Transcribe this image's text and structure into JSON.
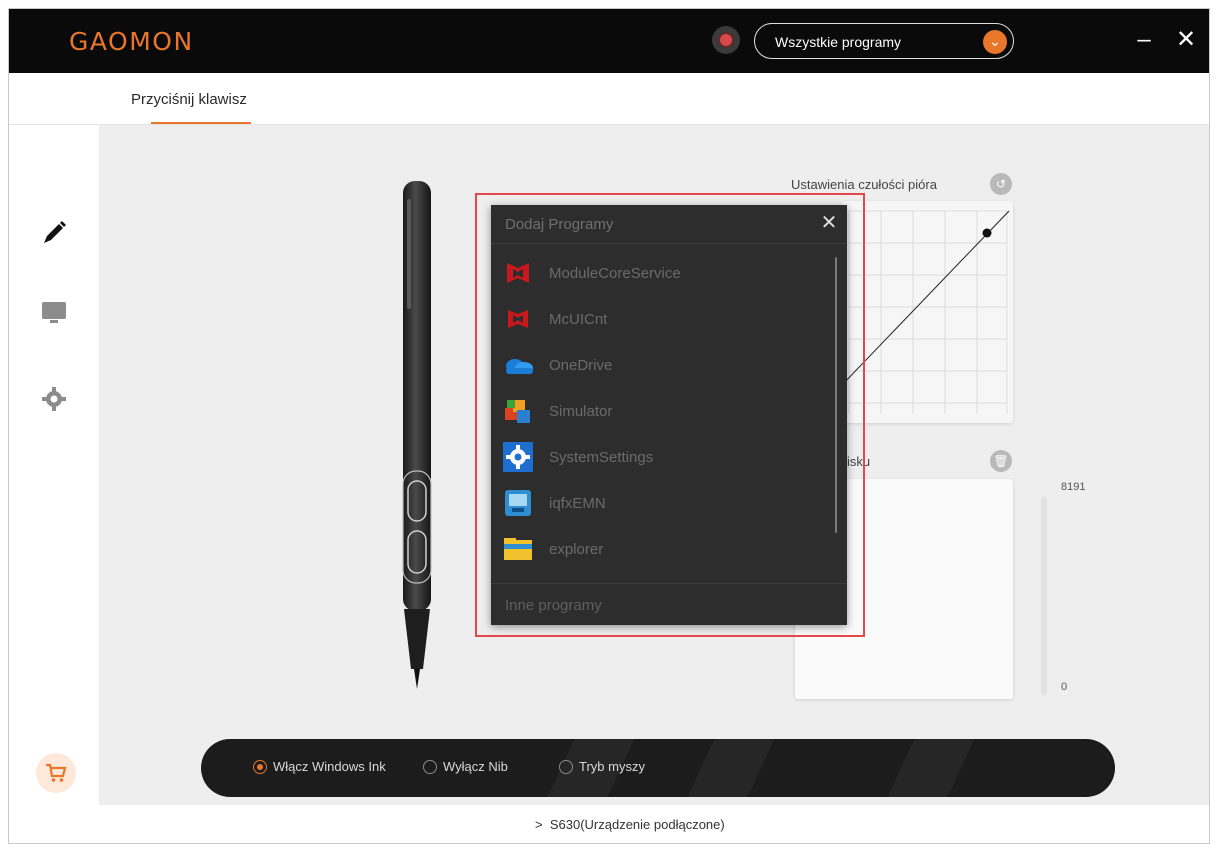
{
  "app": {
    "logo": "GAOMON",
    "program_select": "Wszystkie programy",
    "minimize_label": "–",
    "close_label": "✕"
  },
  "tabs": [
    {
      "label": "Przyciśnij klawisz",
      "active": true
    }
  ],
  "sidebar": {
    "items": [
      {
        "icon": "pen-icon",
        "active": true
      },
      {
        "icon": "monitor-icon",
        "active": false
      },
      {
        "icon": "gear-icon",
        "active": false
      }
    ],
    "shop_icon": "cart-icon"
  },
  "pen_curve": {
    "title": "Ustawienia czułości pióra",
    "reset_icon": "reset-icon"
  },
  "pressure": {
    "title": "isku",
    "max": "8191",
    "min": "0",
    "trash_icon": "trash-icon"
  },
  "dialog": {
    "title": "Dodaj Programy",
    "close_label": "✕",
    "items": [
      {
        "label": "ModuleCoreService",
        "icon": "mcafee-icon"
      },
      {
        "label": "McUICnt",
        "icon": "mcafee-icon"
      },
      {
        "label": "OneDrive",
        "icon": "onedrive-icon"
      },
      {
        "label": "Simulator",
        "icon": "simulator-icon"
      },
      {
        "label": "SystemSettings",
        "icon": "settings-gear-icon"
      },
      {
        "label": "iqfxEMN",
        "icon": "remote-desktop-icon"
      },
      {
        "label": "explorer",
        "icon": "folder-icon"
      }
    ],
    "other_programs": "Inne programy"
  },
  "bottom_options": [
    {
      "label": "Włącz Windows Ink",
      "checked": true
    },
    {
      "label": "Wyłącz Nib",
      "checked": false
    },
    {
      "label": "Tryb myszy",
      "checked": false
    }
  ],
  "status": {
    "chevron": ">",
    "device": "S630(Urządzenie podłączone)"
  },
  "colors": {
    "accent": "#e8762b",
    "titlebar": "#0a0a0a",
    "dialog_bg": "#2d2d2d",
    "highlight": "#e04a4a"
  }
}
